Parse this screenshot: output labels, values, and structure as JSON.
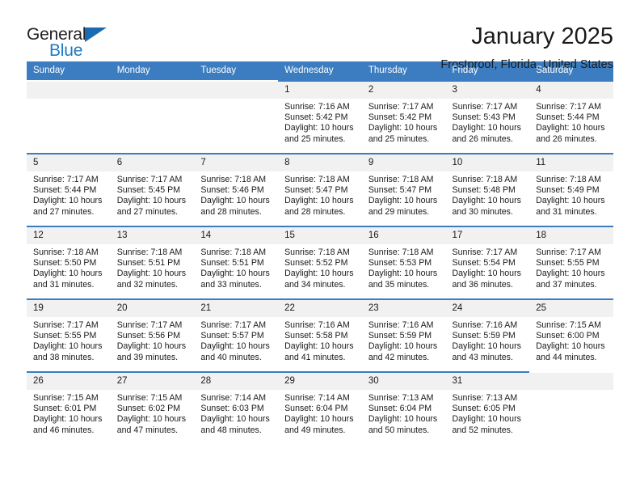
{
  "brand": {
    "name_top": "General",
    "name_bottom": "Blue",
    "triangle_color": "#1b6bb0",
    "blue_text_color": "#1f7ac4"
  },
  "header": {
    "title": "January 2025",
    "subtitle": "Frostproof, Florida, United States"
  },
  "theme": {
    "header_row_bg": "#3b7dc0",
    "daynum_bg": "#f1f1f1",
    "row_rule": "#3b7dc0"
  },
  "weekdays": [
    "Sunday",
    "Monday",
    "Tuesday",
    "Wednesday",
    "Thursday",
    "Friday",
    "Saturday"
  ],
  "labels": {
    "sunrise_prefix": "Sunrise: ",
    "sunset_prefix": "Sunset: ",
    "daylight_prefix": "Daylight: "
  },
  "weeks": [
    [
      {
        "empty": true
      },
      {
        "empty": true
      },
      {
        "empty": true
      },
      {
        "day": "1",
        "sunrise": "Sunrise: 7:16 AM",
        "sunset": "Sunset: 5:42 PM",
        "daylight_line1": "Daylight: 10 hours",
        "daylight_line2": "and 25 minutes."
      },
      {
        "day": "2",
        "sunrise": "Sunrise: 7:17 AM",
        "sunset": "Sunset: 5:42 PM",
        "daylight_line1": "Daylight: 10 hours",
        "daylight_line2": "and 25 minutes."
      },
      {
        "day": "3",
        "sunrise": "Sunrise: 7:17 AM",
        "sunset": "Sunset: 5:43 PM",
        "daylight_line1": "Daylight: 10 hours",
        "daylight_line2": "and 26 minutes."
      },
      {
        "day": "4",
        "sunrise": "Sunrise: 7:17 AM",
        "sunset": "Sunset: 5:44 PM",
        "daylight_line1": "Daylight: 10 hours",
        "daylight_line2": "and 26 minutes."
      }
    ],
    [
      {
        "day": "5",
        "sunrise": "Sunrise: 7:17 AM",
        "sunset": "Sunset: 5:44 PM",
        "daylight_line1": "Daylight: 10 hours",
        "daylight_line2": "and 27 minutes."
      },
      {
        "day": "6",
        "sunrise": "Sunrise: 7:17 AM",
        "sunset": "Sunset: 5:45 PM",
        "daylight_line1": "Daylight: 10 hours",
        "daylight_line2": "and 27 minutes."
      },
      {
        "day": "7",
        "sunrise": "Sunrise: 7:18 AM",
        "sunset": "Sunset: 5:46 PM",
        "daylight_line1": "Daylight: 10 hours",
        "daylight_line2": "and 28 minutes."
      },
      {
        "day": "8",
        "sunrise": "Sunrise: 7:18 AM",
        "sunset": "Sunset: 5:47 PM",
        "daylight_line1": "Daylight: 10 hours",
        "daylight_line2": "and 28 minutes."
      },
      {
        "day": "9",
        "sunrise": "Sunrise: 7:18 AM",
        "sunset": "Sunset: 5:47 PM",
        "daylight_line1": "Daylight: 10 hours",
        "daylight_line2": "and 29 minutes."
      },
      {
        "day": "10",
        "sunrise": "Sunrise: 7:18 AM",
        "sunset": "Sunset: 5:48 PM",
        "daylight_line1": "Daylight: 10 hours",
        "daylight_line2": "and 30 minutes."
      },
      {
        "day": "11",
        "sunrise": "Sunrise: 7:18 AM",
        "sunset": "Sunset: 5:49 PM",
        "daylight_line1": "Daylight: 10 hours",
        "daylight_line2": "and 31 minutes."
      }
    ],
    [
      {
        "day": "12",
        "sunrise": "Sunrise: 7:18 AM",
        "sunset": "Sunset: 5:50 PM",
        "daylight_line1": "Daylight: 10 hours",
        "daylight_line2": "and 31 minutes."
      },
      {
        "day": "13",
        "sunrise": "Sunrise: 7:18 AM",
        "sunset": "Sunset: 5:51 PM",
        "daylight_line1": "Daylight: 10 hours",
        "daylight_line2": "and 32 minutes."
      },
      {
        "day": "14",
        "sunrise": "Sunrise: 7:18 AM",
        "sunset": "Sunset: 5:51 PM",
        "daylight_line1": "Daylight: 10 hours",
        "daylight_line2": "and 33 minutes."
      },
      {
        "day": "15",
        "sunrise": "Sunrise: 7:18 AM",
        "sunset": "Sunset: 5:52 PM",
        "daylight_line1": "Daylight: 10 hours",
        "daylight_line2": "and 34 minutes."
      },
      {
        "day": "16",
        "sunrise": "Sunrise: 7:18 AM",
        "sunset": "Sunset: 5:53 PM",
        "daylight_line1": "Daylight: 10 hours",
        "daylight_line2": "and 35 minutes."
      },
      {
        "day": "17",
        "sunrise": "Sunrise: 7:17 AM",
        "sunset": "Sunset: 5:54 PM",
        "daylight_line1": "Daylight: 10 hours",
        "daylight_line2": "and 36 minutes."
      },
      {
        "day": "18",
        "sunrise": "Sunrise: 7:17 AM",
        "sunset": "Sunset: 5:55 PM",
        "daylight_line1": "Daylight: 10 hours",
        "daylight_line2": "and 37 minutes."
      }
    ],
    [
      {
        "day": "19",
        "sunrise": "Sunrise: 7:17 AM",
        "sunset": "Sunset: 5:55 PM",
        "daylight_line1": "Daylight: 10 hours",
        "daylight_line2": "and 38 minutes."
      },
      {
        "day": "20",
        "sunrise": "Sunrise: 7:17 AM",
        "sunset": "Sunset: 5:56 PM",
        "daylight_line1": "Daylight: 10 hours",
        "daylight_line2": "and 39 minutes."
      },
      {
        "day": "21",
        "sunrise": "Sunrise: 7:17 AM",
        "sunset": "Sunset: 5:57 PM",
        "daylight_line1": "Daylight: 10 hours",
        "daylight_line2": "and 40 minutes."
      },
      {
        "day": "22",
        "sunrise": "Sunrise: 7:16 AM",
        "sunset": "Sunset: 5:58 PM",
        "daylight_line1": "Daylight: 10 hours",
        "daylight_line2": "and 41 minutes."
      },
      {
        "day": "23",
        "sunrise": "Sunrise: 7:16 AM",
        "sunset": "Sunset: 5:59 PM",
        "daylight_line1": "Daylight: 10 hours",
        "daylight_line2": "and 42 minutes."
      },
      {
        "day": "24",
        "sunrise": "Sunrise: 7:16 AM",
        "sunset": "Sunset: 5:59 PM",
        "daylight_line1": "Daylight: 10 hours",
        "daylight_line2": "and 43 minutes."
      },
      {
        "day": "25",
        "sunrise": "Sunrise: 7:15 AM",
        "sunset": "Sunset: 6:00 PM",
        "daylight_line1": "Daylight: 10 hours",
        "daylight_line2": "and 44 minutes."
      }
    ],
    [
      {
        "day": "26",
        "sunrise": "Sunrise: 7:15 AM",
        "sunset": "Sunset: 6:01 PM",
        "daylight_line1": "Daylight: 10 hours",
        "daylight_line2": "and 46 minutes."
      },
      {
        "day": "27",
        "sunrise": "Sunrise: 7:15 AM",
        "sunset": "Sunset: 6:02 PM",
        "daylight_line1": "Daylight: 10 hours",
        "daylight_line2": "and 47 minutes."
      },
      {
        "day": "28",
        "sunrise": "Sunrise: 7:14 AM",
        "sunset": "Sunset: 6:03 PM",
        "daylight_line1": "Daylight: 10 hours",
        "daylight_line2": "and 48 minutes."
      },
      {
        "day": "29",
        "sunrise": "Sunrise: 7:14 AM",
        "sunset": "Sunset: 6:04 PM",
        "daylight_line1": "Daylight: 10 hours",
        "daylight_line2": "and 49 minutes."
      },
      {
        "day": "30",
        "sunrise": "Sunrise: 7:13 AM",
        "sunset": "Sunset: 6:04 PM",
        "daylight_line1": "Daylight: 10 hours",
        "daylight_line2": "and 50 minutes."
      },
      {
        "day": "31",
        "sunrise": "Sunrise: 7:13 AM",
        "sunset": "Sunset: 6:05 PM",
        "daylight_line1": "Daylight: 10 hours",
        "daylight_line2": "and 52 minutes."
      },
      {
        "empty": true
      }
    ]
  ]
}
